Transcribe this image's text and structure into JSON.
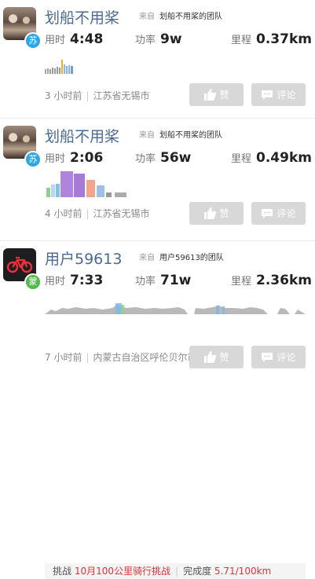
{
  "activities": [
    {
      "name": "划船不用桨",
      "team_prefix": "来自",
      "team": "划船不用桨的团队",
      "badge": "苏",
      "stats": {
        "time_label": "用时",
        "time": "4:48",
        "power_label": "功率",
        "power": "9w",
        "distance_label": "里程",
        "distance": "0.37km"
      },
      "time_ago": "3 小时前",
      "location": "江苏省无锡市",
      "like_label": "赞",
      "comment_label": "评论"
    },
    {
      "name": "划船不用桨",
      "team_prefix": "来自",
      "team": "划船不用桨的团队",
      "badge": "苏",
      "stats": {
        "time_label": "用时",
        "time": "2:06",
        "power_label": "功率",
        "power": "56w",
        "distance_label": "里程",
        "distance": "0.49km"
      },
      "time_ago": "4 小时前",
      "location": "江苏省无锡市",
      "like_label": "赞",
      "comment_label": "评论"
    },
    {
      "name": "用户59613",
      "team_prefix": "来自",
      "team": "用户59613的团队",
      "badge": "蒙",
      "stats": {
        "time_label": "用时",
        "time": "7:33",
        "power_label": "功率",
        "power": "71w",
        "distance_label": "里程",
        "distance": "2.36km"
      },
      "challenge": {
        "label": "挑战",
        "name": "10月100公里骑行挑战",
        "progress_label": "完成度",
        "progress": "5.71/100km"
      },
      "time_ago": "7 小时前",
      "location": "内蒙古自治区呼伦贝尔市",
      "like_label": "赞",
      "comment_label": "评论"
    }
  ],
  "colors": {
    "name": "#4a6a92",
    "button_bg": "#d8d8d8",
    "challenge_red": "#e0323c",
    "badge_blue": "#2aa7e8",
    "badge_green": "#54b84a"
  }
}
